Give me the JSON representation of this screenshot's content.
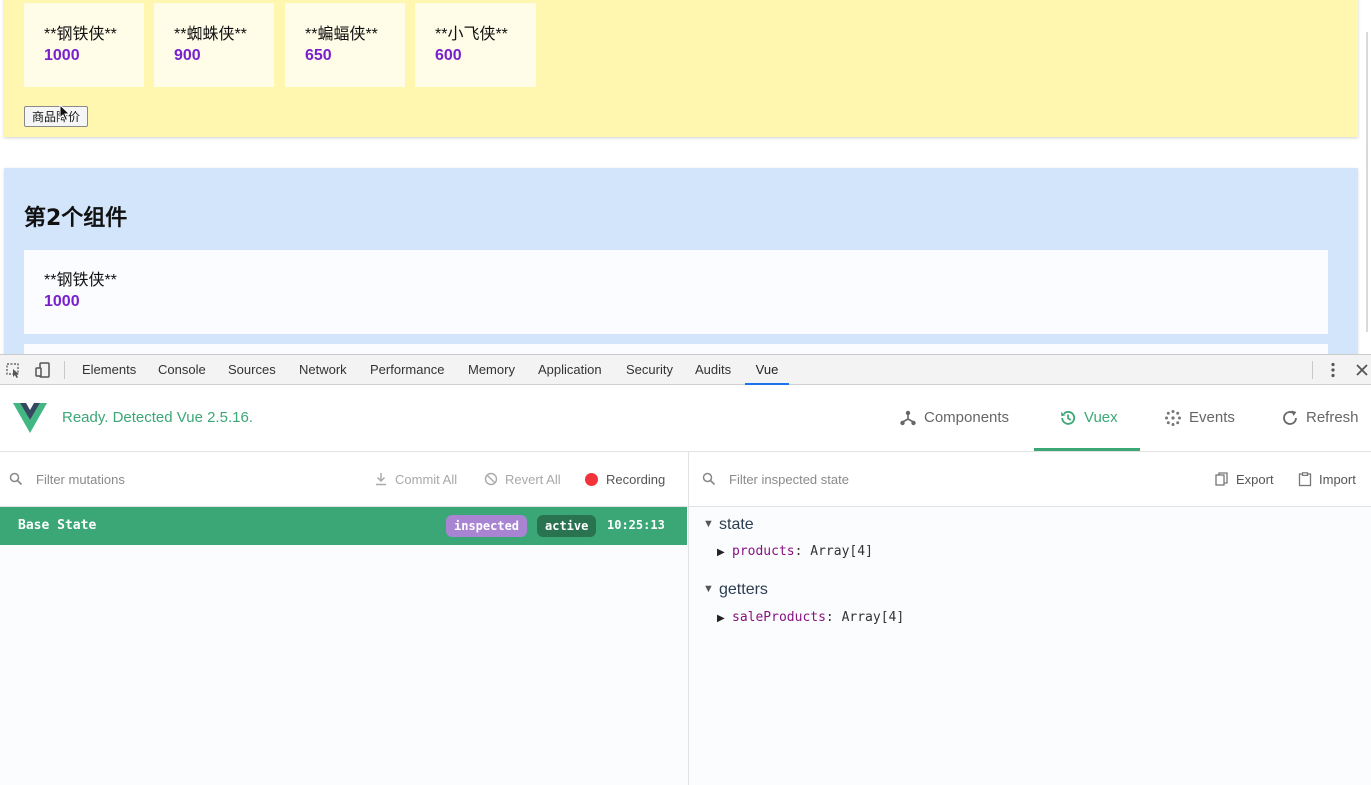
{
  "page": {
    "component1": {
      "products": [
        {
          "name": "**钢铁侠**",
          "price": "1000"
        },
        {
          "name": "**蜘蛛侠**",
          "price": "900"
        },
        {
          "name": "**蝙蝠侠**",
          "price": "650"
        },
        {
          "name": "**小飞侠**",
          "price": "600"
        }
      ],
      "button_label": "商品降价"
    },
    "component2": {
      "title": "第2个组件",
      "products": [
        {
          "name": "**钢铁侠**",
          "price": "1000"
        }
      ]
    }
  },
  "devtools": {
    "tabs": [
      "Elements",
      "Console",
      "Sources",
      "Network",
      "Performance",
      "Memory",
      "Application",
      "Security",
      "Audits",
      "Vue"
    ],
    "active_tab": "Vue"
  },
  "vue": {
    "status": "Ready. Detected Vue 2.5.16.",
    "nav": {
      "components": "Components",
      "vuex": "Vuex",
      "events": "Events",
      "refresh": "Refresh"
    },
    "mutations": {
      "filter_placeholder": "Filter mutations",
      "commit_all": "Commit All",
      "revert_all": "Revert All",
      "recording": "Recording",
      "base": {
        "label": "Base State",
        "badge_inspected": "inspected",
        "badge_active": "active",
        "time": "10:25:13"
      }
    },
    "state_panel": {
      "filter_placeholder": "Filter inspected state",
      "export": "Export",
      "import": "Import",
      "state_title": "state",
      "state_key": "products",
      "state_value": "Array[4]",
      "getters_title": "getters",
      "getters_key": "saleProducts",
      "getters_value": "Array[4]"
    }
  },
  "colors": {
    "vue_green": "#3ba776",
    "component1_bg": "#fff7b0",
    "component2_bg": "#d2e5fb",
    "price_purple": "#7a1fcf",
    "inspected_badge": "#a884d2",
    "active_badge": "#2a7350",
    "record_red": "#f2333a",
    "devtools_active_tab": "#1a73e8"
  }
}
